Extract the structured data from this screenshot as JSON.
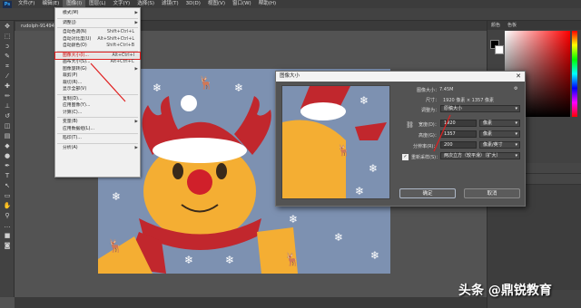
{
  "menubar": {
    "items": [
      "文件(F)",
      "编辑(E)",
      "图像(I)",
      "图层(L)",
      "文字(Y)",
      "选择(S)",
      "滤镜(T)",
      "3D(D)",
      "视图(V)",
      "窗口(W)",
      "帮助(H)"
    ]
  },
  "document_tab": "rudolph-91494...",
  "right_panel": {
    "tab_color": "颜色",
    "tab_swatches": "色板"
  },
  "image_menu": {
    "items": [
      {
        "label": "模式(M)",
        "shortcut": "",
        "submenu": true
      },
      {
        "label": "调整(J)",
        "shortcut": "",
        "submenu": true
      },
      {
        "label": "自动色调(N)",
        "shortcut": "Shift+Ctrl+L",
        "submenu": false
      },
      {
        "label": "自动对比度(U)",
        "shortcut": "Alt+Shift+Ctrl+L",
        "submenu": false
      },
      {
        "label": "自动颜色(O)",
        "shortcut": "Shift+Ctrl+B",
        "submenu": false
      },
      {
        "label": "图像大小(I)...",
        "shortcut": "Alt+Ctrl+I",
        "submenu": false
      },
      {
        "label": "画布大小(S)...",
        "shortcut": "Alt+Ctrl+C",
        "submenu": false
      },
      {
        "label": "图像旋转(G)",
        "shortcut": "",
        "submenu": true
      },
      {
        "label": "裁剪(P)",
        "shortcut": "",
        "submenu": false
      },
      {
        "label": "裁切(R)...",
        "shortcut": "",
        "submenu": false
      },
      {
        "label": "显示全部(V)",
        "shortcut": "",
        "submenu": false
      },
      {
        "label": "复制(D)...",
        "shortcut": "",
        "submenu": false
      },
      {
        "label": "应用图像(Y)...",
        "shortcut": "",
        "submenu": false
      },
      {
        "label": "计算(C)...",
        "shortcut": "",
        "submenu": false
      },
      {
        "label": "变量(B)",
        "shortcut": "",
        "submenu": true
      },
      {
        "label": "应用数据组(L)...",
        "shortcut": "",
        "submenu": false
      },
      {
        "label": "陷印(T)...",
        "shortcut": "",
        "submenu": false
      },
      {
        "label": "分析(A)",
        "shortcut": "",
        "submenu": true
      }
    ]
  },
  "dialog": {
    "title": "图像大小",
    "image_size_label": "图像大小：",
    "image_size_value": "7.45M",
    "dimensions_label": "尺寸：",
    "dimensions_value": "1920 像素 × 1357 像素",
    "fit_label": "调整为：",
    "fit_value": "原稿大小",
    "width_label": "宽度(D)：",
    "width_value": "1920",
    "width_unit": "像素",
    "height_label": "高度(G)：",
    "height_value": "1357",
    "height_unit": "像素",
    "resolution_label": "分辨率(R)：",
    "resolution_value": "200",
    "resolution_unit": "像素/英寸",
    "resample_label": "重新采样(S)：",
    "resample_value": "两次立方（较平滑）（扩大）",
    "ok_label": "确定",
    "cancel_label": "取消"
  },
  "watermark": "头条 @鼎锐教育",
  "colors": {
    "accent_red": "#e02020",
    "ps_blue": "#31a8ff"
  }
}
